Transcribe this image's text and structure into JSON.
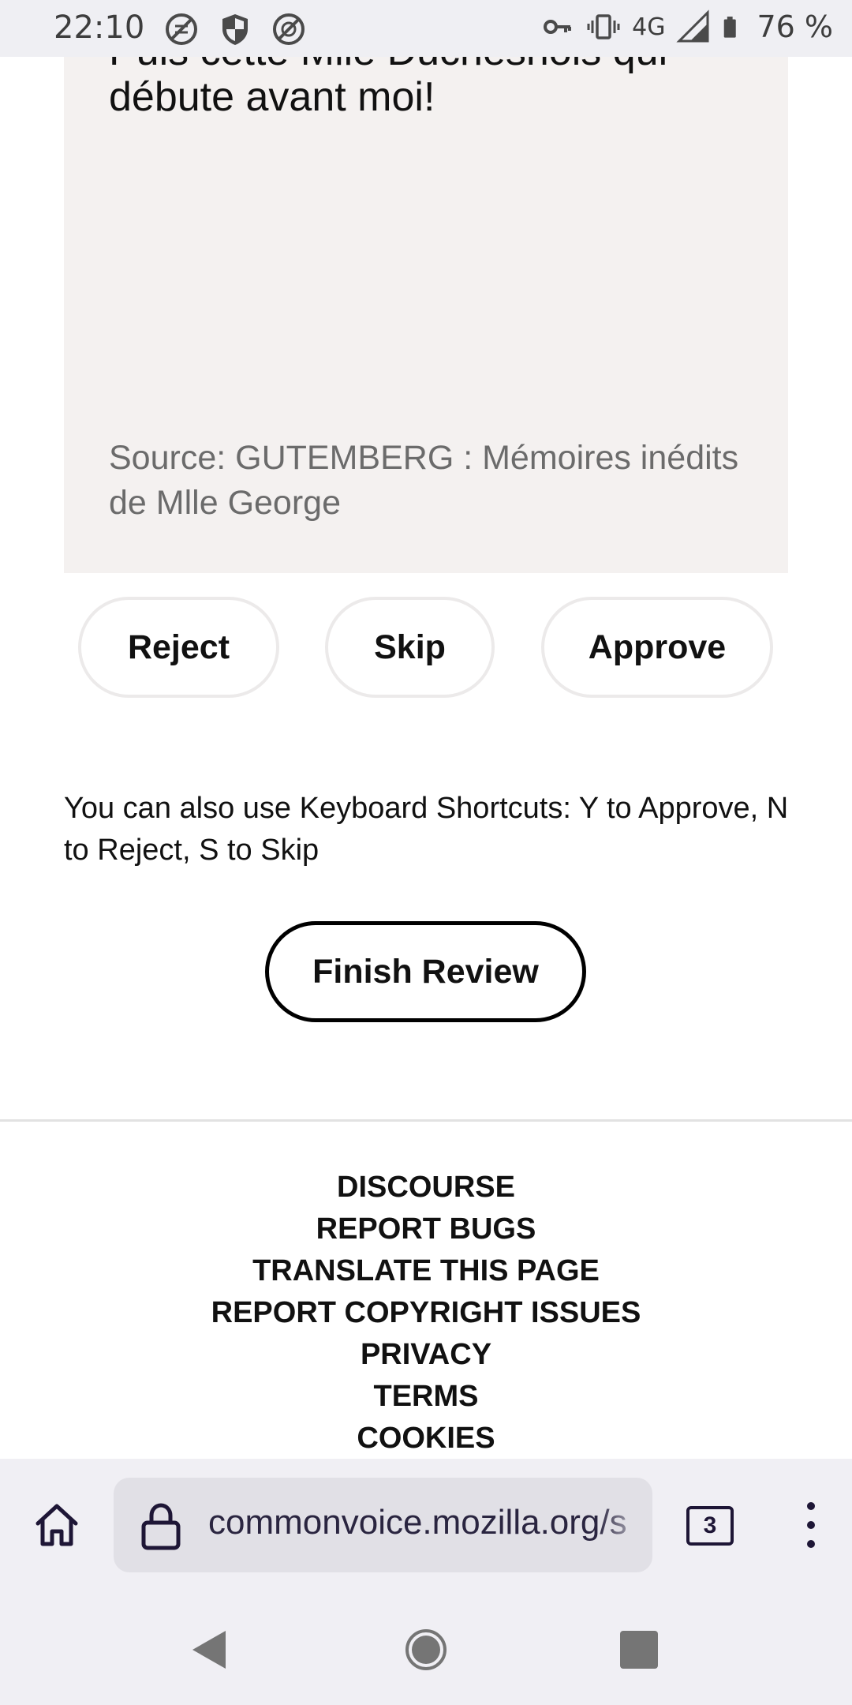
{
  "status_bar": {
    "time": "22:10",
    "network": "4G",
    "battery_percent": "76 %",
    "left_icons": [
      "no-sync-icon",
      "shield-icon",
      "no-data-icon"
    ],
    "right_icons": [
      "vpn-key-icon",
      "vibrate-icon",
      "signal-icon",
      "battery-icon"
    ]
  },
  "review": {
    "sentence_line1": "Puis cette Mlle Duchesnois qui",
    "sentence_line2": "débute avant moi!",
    "source": "Source: GUTEMBERG : Mémoires inédits de Mlle George",
    "reject_label": "Reject",
    "skip_label": "Skip",
    "approve_label": "Approve",
    "shortcuts_text": "You can also use Keyboard Shortcuts: Y to Approve, N to Reject, S to Skip",
    "finish_label": "Finish Review"
  },
  "footer": {
    "links": [
      "DISCOURSE",
      "REPORT BUGS",
      "TRANSLATE THIS PAGE",
      "REPORT COPYRIGHT ISSUES",
      "PRIVACY",
      "TERMS",
      "COOKIES"
    ]
  },
  "browser": {
    "url": "commonvoice.mozilla.org/s",
    "tab_count": "3"
  }
}
